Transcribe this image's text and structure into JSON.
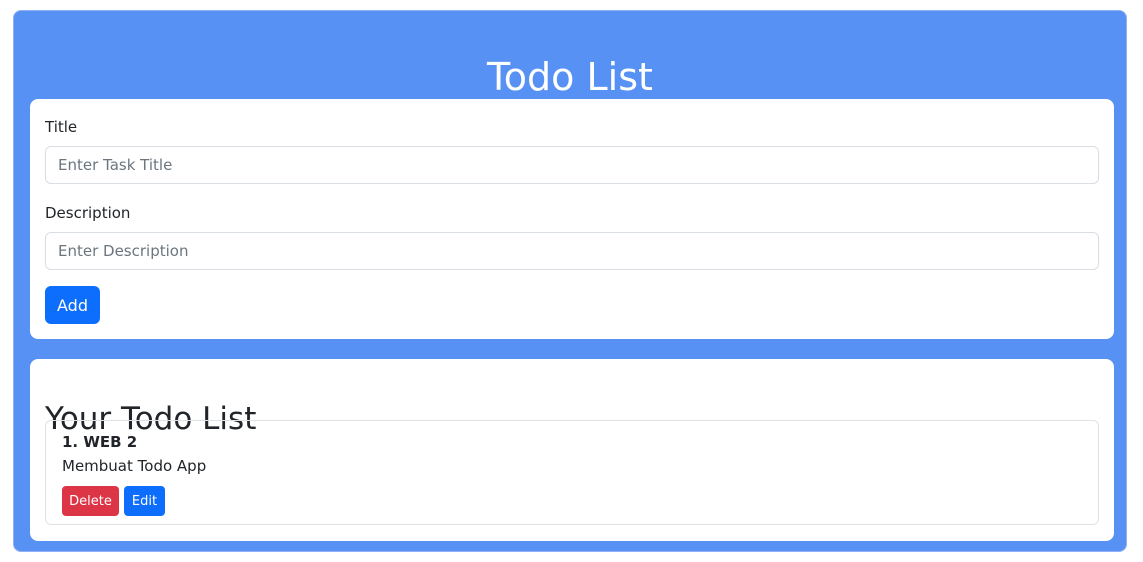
{
  "app": {
    "title": "Todo List"
  },
  "form": {
    "title_label": "Title",
    "title_placeholder": "Enter Task Title",
    "description_label": "Description",
    "description_placeholder": "Enter Description",
    "add_label": "Add"
  },
  "todo_list": {
    "heading": "Your Todo List",
    "items": [
      {
        "title": "1. WEB 2",
        "description": "Membuat Todo App",
        "delete_label": "Delete",
        "edit_label": "Edit"
      }
    ]
  },
  "colors": {
    "page_accent": "#5791f4",
    "primary_button": "#0d6efd",
    "danger_button": "#dc3545"
  }
}
